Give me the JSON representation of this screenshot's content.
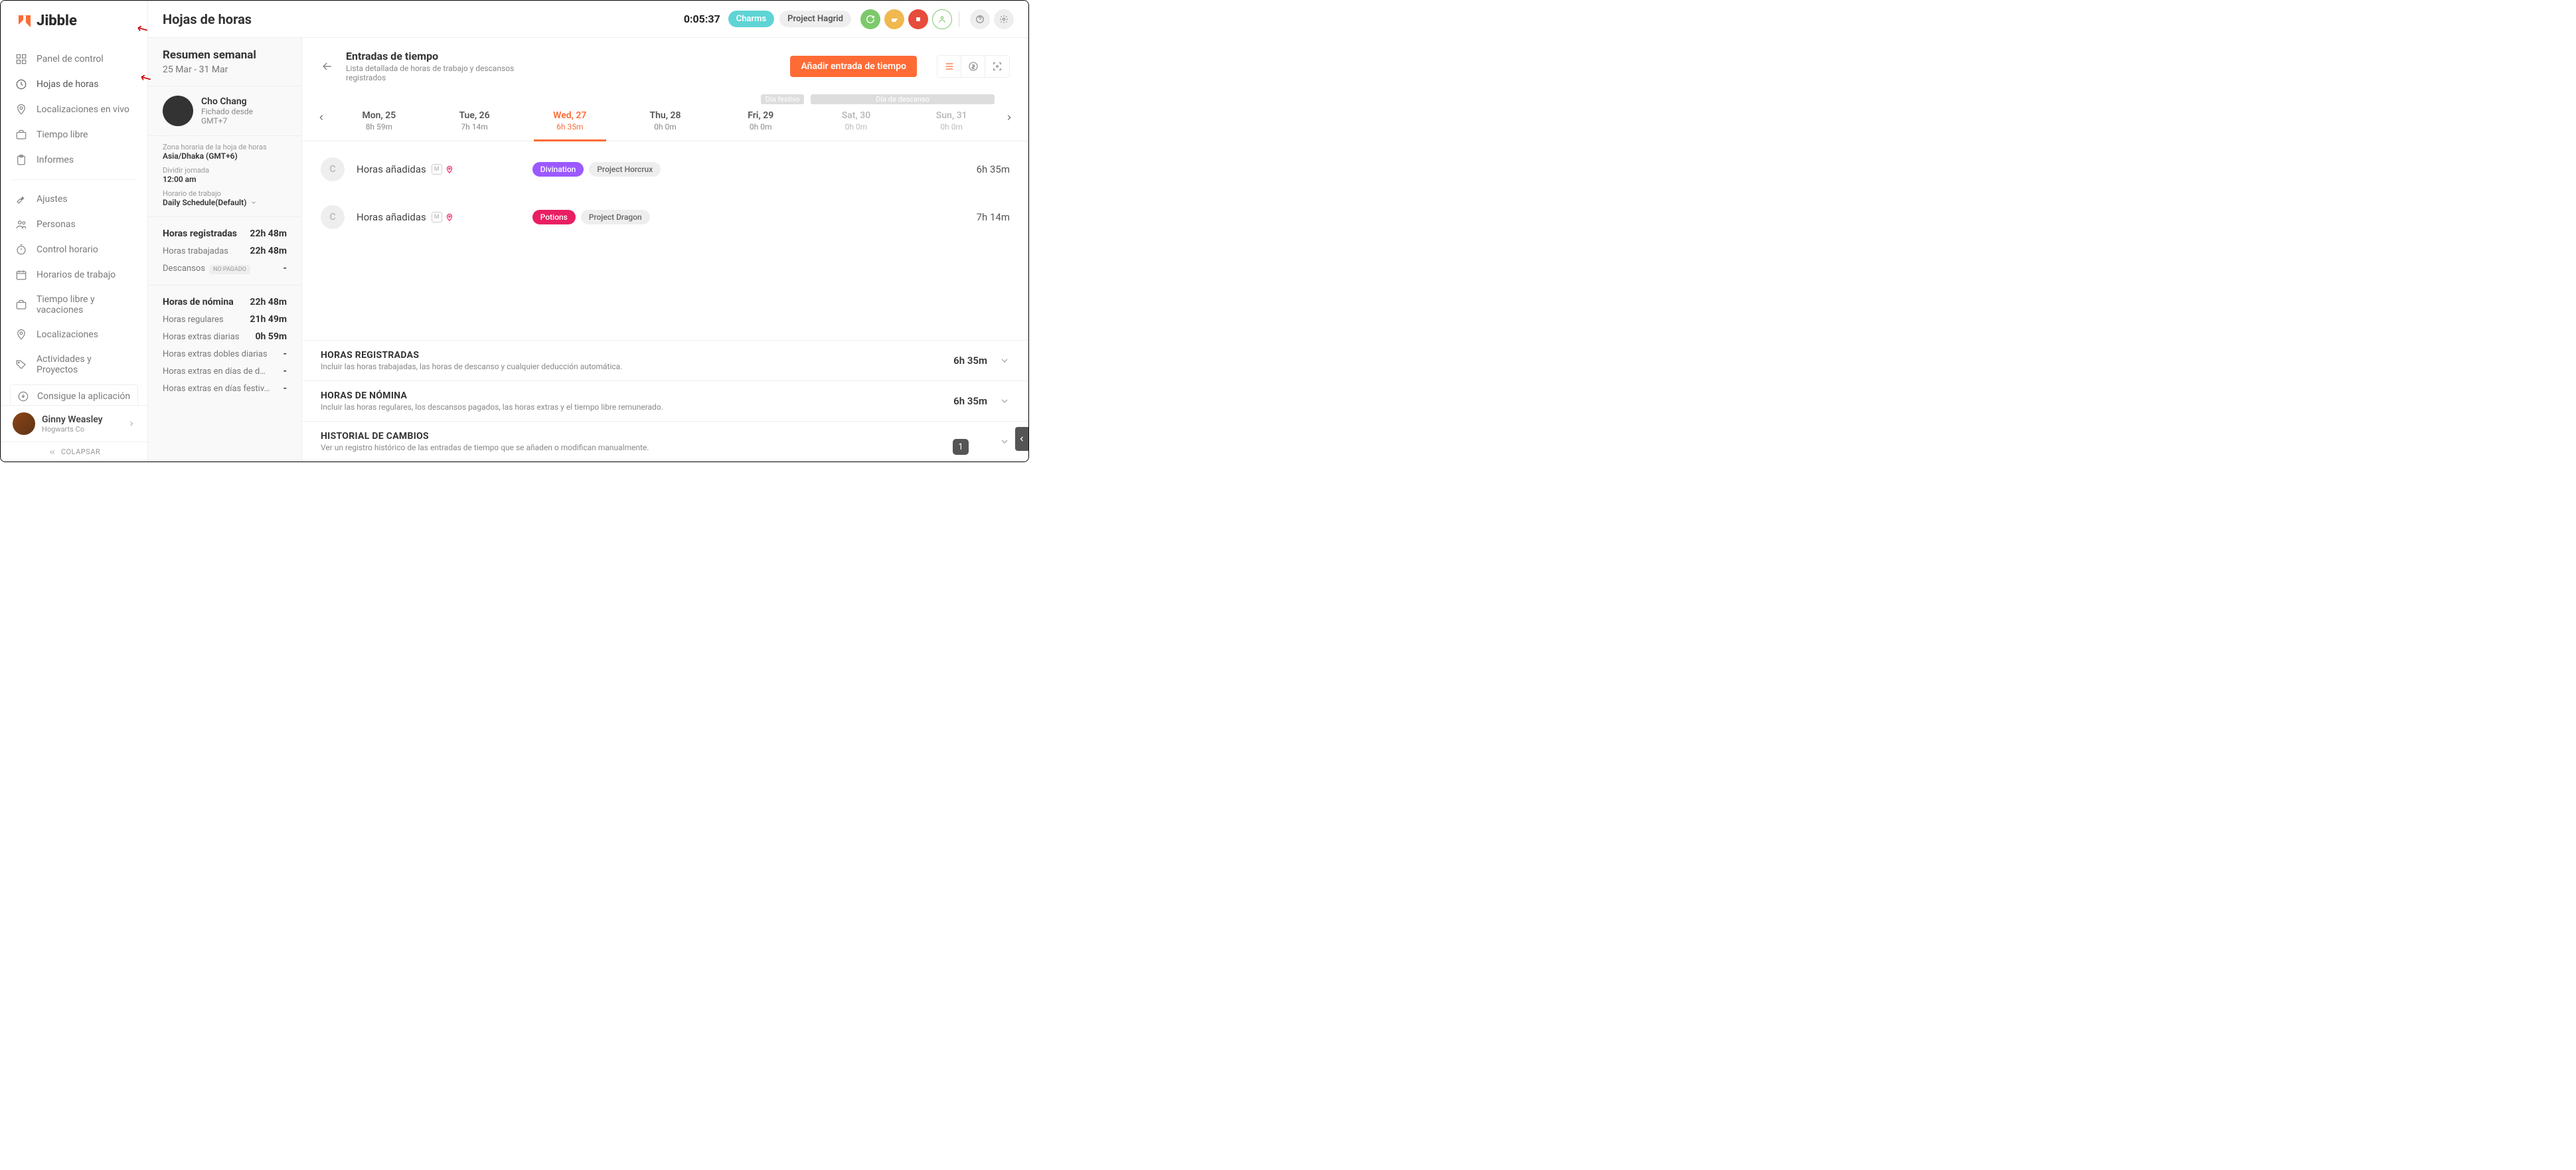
{
  "brand": "Jibble",
  "pageTitle": "Hojas de horas",
  "timer": "0:05:37",
  "chips": {
    "activity": "Charms",
    "project": "Project Hagrid"
  },
  "nav": {
    "dashboard": "Panel de control",
    "timesheets": "Hojas de horas",
    "liveLocations": "Localizaciones en vivo",
    "timeoff": "Tiempo libre",
    "reports": "Informes",
    "settings": "Ajustes",
    "people": "Personas",
    "timeControl": "Control horario",
    "schedules": "Horarios de trabajo",
    "holidays": "Tiempo libre y vacaciones",
    "locations": "Localizaciones",
    "activities": "Actividades y Proyectos",
    "getApp": "Consigue la aplicación"
  },
  "footerUser": {
    "name": "Ginny Weasley",
    "company": "Hogwarts Co"
  },
  "collapse": "COLAPSAR",
  "summary": {
    "title": "Resumen semanal",
    "range": "25 Mar - 31 Mar",
    "profile": {
      "name": "Cho Chang",
      "status": "Fichado desde",
      "tz": "GMT+7"
    },
    "tzLabel": "Zona horaria de la hoja de horas",
    "tzValue": "Asia/Dhaka (GMT+6)",
    "splitLabel": "Dividir jornada",
    "splitValue": "12:00 am",
    "scheduleLabel": "Horario de trabajo",
    "scheduleValue": "Daily Schedule(Default)",
    "stats1": {
      "tracked": {
        "label": "Horas registradas",
        "val": "22h 48m"
      },
      "worked": {
        "label": "Horas trabajadas",
        "val": "22h 48m"
      },
      "breaks": {
        "label": "Descansos",
        "badge": "NO PAGADO",
        "val": "-"
      }
    },
    "stats2": {
      "payroll": {
        "label": "Horas de nómina",
        "val": "22h 48m"
      },
      "regular": {
        "label": "Horas regulares",
        "val": "21h 49m"
      },
      "dailyOt": {
        "label": "Horas extras diarias",
        "val": "0h 59m"
      },
      "doubleOt": {
        "label": "Horas extras dobles diarias",
        "val": "-"
      },
      "restOt": {
        "label": "Horas extras en días de d…",
        "val": "-"
      },
      "holOt": {
        "label": "Horas extras en días festiv…",
        "val": "-"
      }
    }
  },
  "mainHeader": {
    "title": "Entradas de tiempo",
    "sub": "Lista detallada de horas de trabajo y descansos registrados",
    "addBtn": "Añadir entrada de tiempo"
  },
  "holidayLabels": {
    "holiday": "Día festivo",
    "restday": "Día de descanso"
  },
  "days": [
    {
      "label": "Mon, 25",
      "dur": "8h 59m",
      "active": false,
      "off": false
    },
    {
      "label": "Tue, 26",
      "dur": "7h 14m",
      "active": false,
      "off": false
    },
    {
      "label": "Wed, 27",
      "dur": "6h 35m",
      "active": true,
      "off": false
    },
    {
      "label": "Thu, 28",
      "dur": "0h 0m",
      "active": false,
      "off": false
    },
    {
      "label": "Fri, 29",
      "dur": "0h 0m",
      "active": false,
      "off": false
    },
    {
      "label": "Sat, 30",
      "dur": "0h 0m",
      "active": false,
      "off": true
    },
    {
      "label": "Sun, 31",
      "dur": "0h 0m",
      "active": false,
      "off": true
    }
  ],
  "entries": [
    {
      "avatar": "C",
      "title": "Horas añadidas",
      "tag1": "Divination",
      "tag1Class": "tag-purple",
      "tag2": "Project Horcrux",
      "dur": "6h 35m"
    },
    {
      "avatar": "C",
      "title": "Horas añadidas",
      "tag1": "Potions",
      "tag1Class": "tag-pink",
      "tag2": "Project Dragon",
      "dur": "7h 14m"
    }
  ],
  "sections": {
    "tracked": {
      "title": "HORAS REGISTRADAS",
      "sub": "Incluir las horas trabajadas, las horas de descanso y cualquier deducción automática.",
      "val": "6h 35m"
    },
    "payroll": {
      "title": "HORAS DE NÓMINA",
      "sub": "Incluir las horas regulares, los descansos pagados, las horas extras y el tiempo libre remunerado.",
      "val": "6h 35m"
    },
    "history": {
      "title": "HISTORIAL DE CAMBIOS",
      "sub": "Ver un registro histórico de las entradas de tiempo que se añaden o modifican manualmente."
    }
  },
  "pageBadge": "1"
}
